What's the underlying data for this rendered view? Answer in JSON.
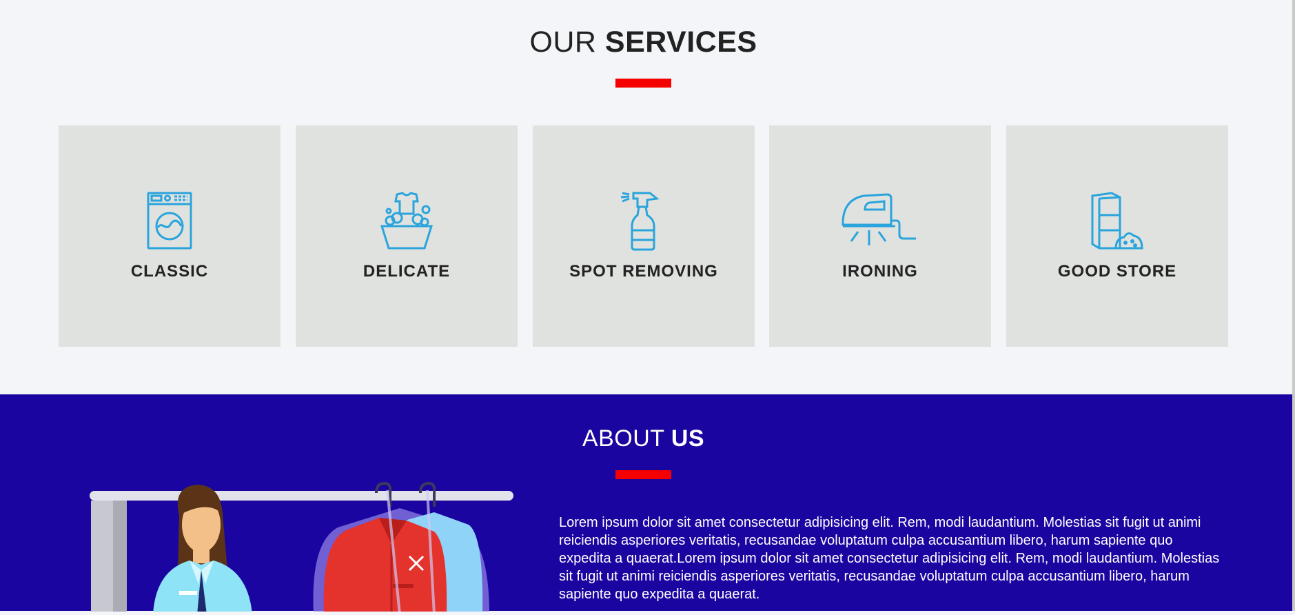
{
  "services": {
    "title_light": "OUR",
    "title_bold": "SERVICES",
    "cards": [
      {
        "label": "CLASSIC",
        "icon": "washing-machine-icon"
      },
      {
        "label": "DELICATE",
        "icon": "hand-wash-basin-icon"
      },
      {
        "label": "SPOT REMOVING",
        "icon": "spray-bottle-icon"
      },
      {
        "label": "IRONING",
        "icon": "iron-icon"
      },
      {
        "label": "GOOD STORE",
        "icon": "storage-box-icon"
      }
    ]
  },
  "about": {
    "title_light": "ABOUT",
    "title_bold": "US",
    "text": "Lorem ipsum dolor sit amet consectetur adipisicing elit. Rem, modi laudantium. Molestias sit fugit ut animi reiciendis asperiores veritatis, recusandae voluptatum culpa accusantium libero, harum sapiente quo expedita a quaerat.Lorem ipsum dolor sit amet consectetur adipisicing elit. Rem, modi laudantium. Molestias sit fugit ut animi reiciendis asperiores veritatis, recusandae voluptatum culpa accusantium libero, harum sapiente quo expedita a quaerat."
  },
  "colors": {
    "accent_red": "#f40000",
    "about_bg": "#1b05a0",
    "icon_blue": "#29a4dc",
    "card_bg": "#e0e2df"
  }
}
